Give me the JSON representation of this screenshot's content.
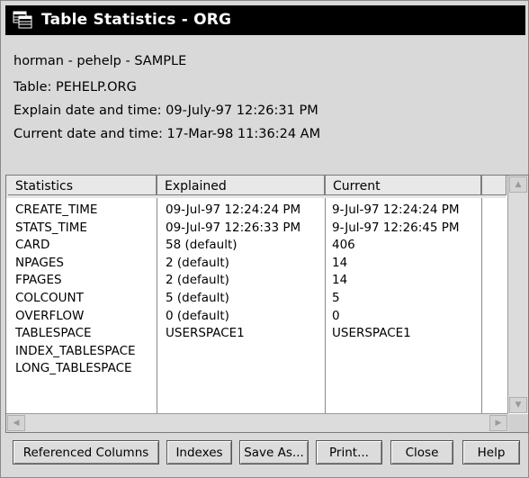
{
  "window": {
    "title": "Table Statistics - ORG"
  },
  "info": {
    "connection": "horman - pehelp - SAMPLE",
    "table": "Table: PEHELP.ORG",
    "explain_time": "Explain date and time: 09-July-97 12:26:31 PM",
    "current_time": "Current date and time: 17-Mar-98 11:36:24 AM"
  },
  "table": {
    "columns": [
      "Statistics",
      "Explained",
      "Current"
    ],
    "rows": [
      [
        "CREATE_TIME",
        "09-Jul-97 12:24:24 PM",
        "9-Jul-97 12:24:24 PM"
      ],
      [
        "STATS_TIME",
        "09-Jul-97 12:26:33 PM",
        "9-Jul-97 12:26:45 PM"
      ],
      [
        "CARD",
        "58 (default)",
        "406"
      ],
      [
        "NPAGES",
        "2 (default)",
        "14"
      ],
      [
        "FPAGES",
        "2 (default)",
        "14"
      ],
      [
        "COLCOUNT",
        "5 (default)",
        "5"
      ],
      [
        "OVERFLOW",
        "0 (default)",
        "0"
      ],
      [
        "TABLESPACE",
        "USERSPACE1",
        "USERSPACE1"
      ],
      [
        "INDEX_TABLESPACE",
        "",
        ""
      ],
      [
        "LONG_TABLESPACE",
        "",
        ""
      ]
    ]
  },
  "buttons": {
    "referenced_columns": "Referenced Columns",
    "indexes": "Indexes",
    "save_as": "Save As...",
    "print": "Print...",
    "close": "Close",
    "help": "Help"
  },
  "icons": {
    "title": "table-icon",
    "scroll_up": "arrow-up-icon",
    "scroll_down": "arrow-down-icon",
    "scroll_left": "arrow-left-icon",
    "scroll_right": "arrow-right-icon"
  }
}
